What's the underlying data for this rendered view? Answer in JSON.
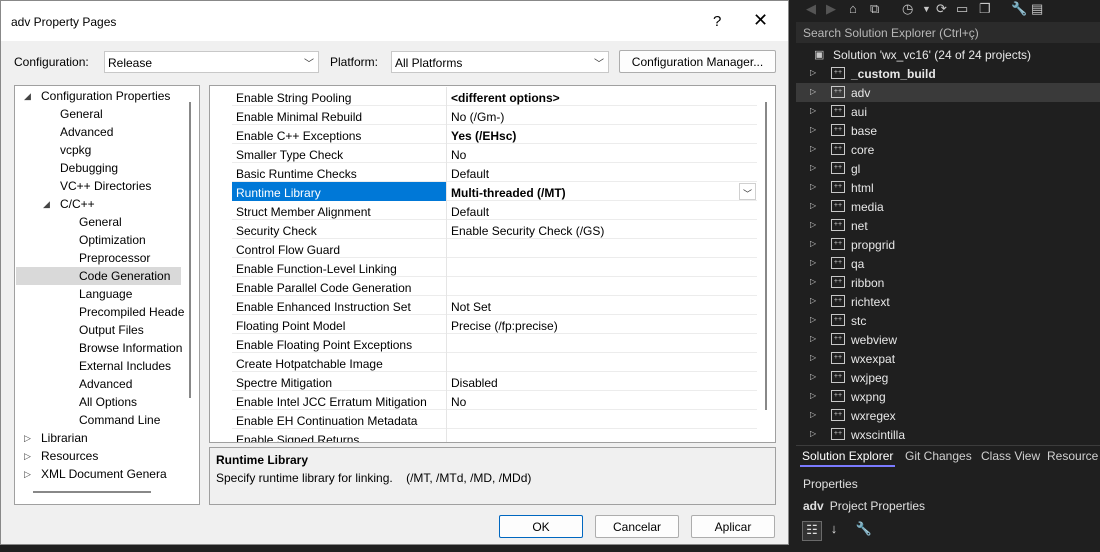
{
  "dialog": {
    "title": "adv Property Pages",
    "help_glyph": "?",
    "close_glyph": "✕",
    "configuration_label": "Configuration:",
    "configuration_value": "Release",
    "platform_label": "Platform:",
    "platform_value": "All Platforms",
    "config_manager_label": "Configuration Manager...",
    "ok_label": "OK",
    "cancel_label": "Cancelar",
    "apply_label": "Aplicar"
  },
  "tree": {
    "items": [
      {
        "label": "Configuration Properties",
        "exp": "◢"
      },
      {
        "label": "General"
      },
      {
        "label": "Advanced"
      },
      {
        "label": "vcpkg"
      },
      {
        "label": "Debugging"
      },
      {
        "label": "VC++ Directories"
      },
      {
        "label": "C/C++",
        "exp": "◢"
      },
      {
        "label": "General"
      },
      {
        "label": "Optimization"
      },
      {
        "label": "Preprocessor"
      },
      {
        "label": "Code Generation",
        "selected": true
      },
      {
        "label": "Language"
      },
      {
        "label": "Precompiled Heade"
      },
      {
        "label": "Output Files"
      },
      {
        "label": "Browse Information"
      },
      {
        "label": "External Includes"
      },
      {
        "label": "Advanced"
      },
      {
        "label": "All Options"
      },
      {
        "label": "Command Line"
      },
      {
        "label": "Librarian",
        "exp": "▷"
      },
      {
        "label": "Resources",
        "exp": "▷"
      },
      {
        "label": "XML Document Genera",
        "exp": "▷"
      }
    ]
  },
  "grid": {
    "rows": [
      {
        "name": "Enable String Pooling",
        "value": "<different options>",
        "bold": true
      },
      {
        "name": "Enable Minimal Rebuild",
        "value": "No (/Gm-)"
      },
      {
        "name": "Enable C++ Exceptions",
        "value": "Yes (/EHsc)",
        "bold": true
      },
      {
        "name": "Smaller Type Check",
        "value": "No"
      },
      {
        "name": "Basic Runtime Checks",
        "value": "Default"
      },
      {
        "name": "Runtime Library",
        "value": "Multi-threaded (/MT)",
        "bold": true,
        "selected": true
      },
      {
        "name": "Struct Member Alignment",
        "value": "Default"
      },
      {
        "name": "Security Check",
        "value": "Enable Security Check (/GS)"
      },
      {
        "name": "Control Flow Guard",
        "value": ""
      },
      {
        "name": "Enable Function-Level Linking",
        "value": ""
      },
      {
        "name": "Enable Parallel Code Generation",
        "value": ""
      },
      {
        "name": "Enable Enhanced Instruction Set",
        "value": "Not Set"
      },
      {
        "name": "Floating Point Model",
        "value": "Precise (/fp:precise)"
      },
      {
        "name": "Enable Floating Point Exceptions",
        "value": ""
      },
      {
        "name": "Create Hotpatchable Image",
        "value": ""
      },
      {
        "name": "Spectre Mitigation",
        "value": "Disabled"
      },
      {
        "name": "Enable Intel JCC Erratum Mitigation",
        "value": "No"
      },
      {
        "name": "Enable EH Continuation Metadata",
        "value": ""
      },
      {
        "name": "Enable Signed Returns",
        "value": ""
      }
    ]
  },
  "description": {
    "title": "Runtime Library",
    "text": "Specify runtime library for linking.    (/MT, /MTd, /MD, /MDd)"
  },
  "solution_explorer": {
    "search_placeholder": "Search Solution Explorer (Ctrl+ç)",
    "solution_label": "Solution 'wx_vc16' (24 of 24 projects)",
    "projects": [
      {
        "name": "_custom_build",
        "bold": true
      },
      {
        "name": "adv",
        "selected": true
      },
      {
        "name": "aui"
      },
      {
        "name": "base"
      },
      {
        "name": "core"
      },
      {
        "name": "gl"
      },
      {
        "name": "html"
      },
      {
        "name": "media"
      },
      {
        "name": "net"
      },
      {
        "name": "propgrid"
      },
      {
        "name": "qa"
      },
      {
        "name": "ribbon"
      },
      {
        "name": "richtext"
      },
      {
        "name": "stc"
      },
      {
        "name": "webview"
      },
      {
        "name": "wxexpat"
      },
      {
        "name": "wxjpeg"
      },
      {
        "name": "wxpng"
      },
      {
        "name": "wxregex"
      },
      {
        "name": "wxscintilla"
      }
    ],
    "tabs": [
      "Solution Explorer",
      "Git Changes",
      "Class View",
      "Resource V"
    ]
  },
  "properties_panel": {
    "title": "Properties",
    "object_name": "adv",
    "object_type": "Project Properties"
  },
  "colors": {
    "selection": "#0078d7",
    "dark_bg": "#1f1f1f",
    "dialog_bg": "#f0f0f0"
  }
}
